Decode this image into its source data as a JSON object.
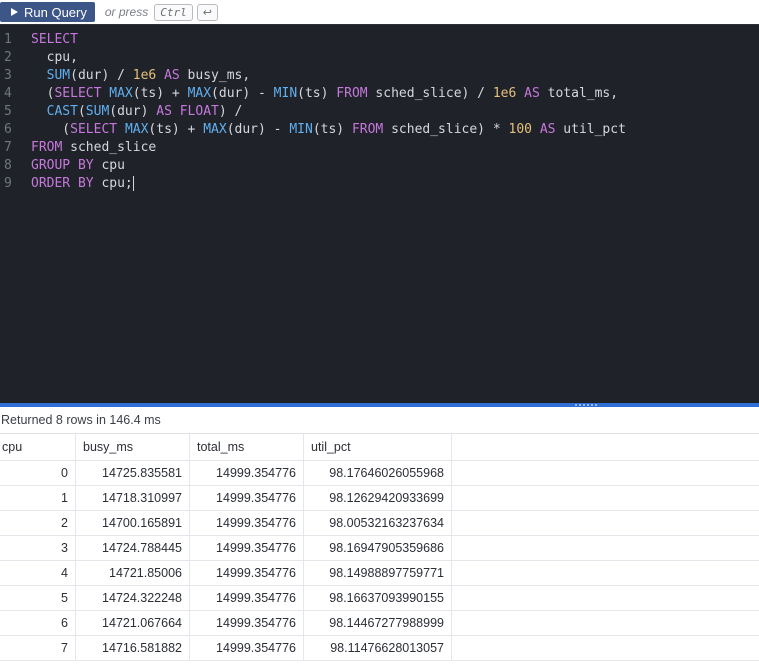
{
  "toolbar": {
    "run_label": "Run Query",
    "or_press": "or press",
    "shortcut_key": "Ctrl",
    "enter_key": "↩"
  },
  "editor": {
    "line_numbers": [
      "1",
      "2",
      "3",
      "4",
      "5",
      "6",
      "7",
      "8",
      "9"
    ],
    "lines": [
      "SELECT",
      "  cpu,",
      "  SUM(dur) / 1e6 AS busy_ms,",
      "  (SELECT MAX(ts) + MAX(dur) - MIN(ts) FROM sched_slice) / 1e6 AS total_ms,",
      "  CAST(SUM(dur) AS FLOAT) /",
      "    (SELECT MAX(ts) + MAX(dur) - MIN(ts) FROM sched_slice) * 100 AS util_pct",
      "FROM sched_slice",
      "GROUP BY cpu",
      "ORDER BY cpu;"
    ]
  },
  "results": {
    "status": "Returned 8 rows in 146.4 ms",
    "columns": [
      "cpu",
      "busy_ms",
      "total_ms",
      "util_pct"
    ],
    "rows": [
      [
        "0",
        "14725.835581",
        "14999.354776",
        "98.17646026055968"
      ],
      [
        "1",
        "14718.310997",
        "14999.354776",
        "98.12629420933699"
      ],
      [
        "2",
        "14700.165891",
        "14999.354776",
        "98.00532163237634"
      ],
      [
        "3",
        "14724.788445",
        "14999.354776",
        "98.16947905359686"
      ],
      [
        "4",
        "14721.85006",
        "14999.354776",
        "98.14988897759771"
      ],
      [
        "5",
        "14724.322248",
        "14999.354776",
        "98.16637093990155"
      ],
      [
        "6",
        "14721.067664",
        "14999.354776",
        "98.14467277988999"
      ],
      [
        "7",
        "14716.581882",
        "14999.354776",
        "98.11476628013057"
      ]
    ]
  },
  "colors": {
    "run_button": "#3d5688",
    "editor_bg": "#1f2228",
    "keyword": "#c678dd",
    "function": "#61afef",
    "number": "#e5c07b",
    "divider": "#2f6fd6"
  }
}
